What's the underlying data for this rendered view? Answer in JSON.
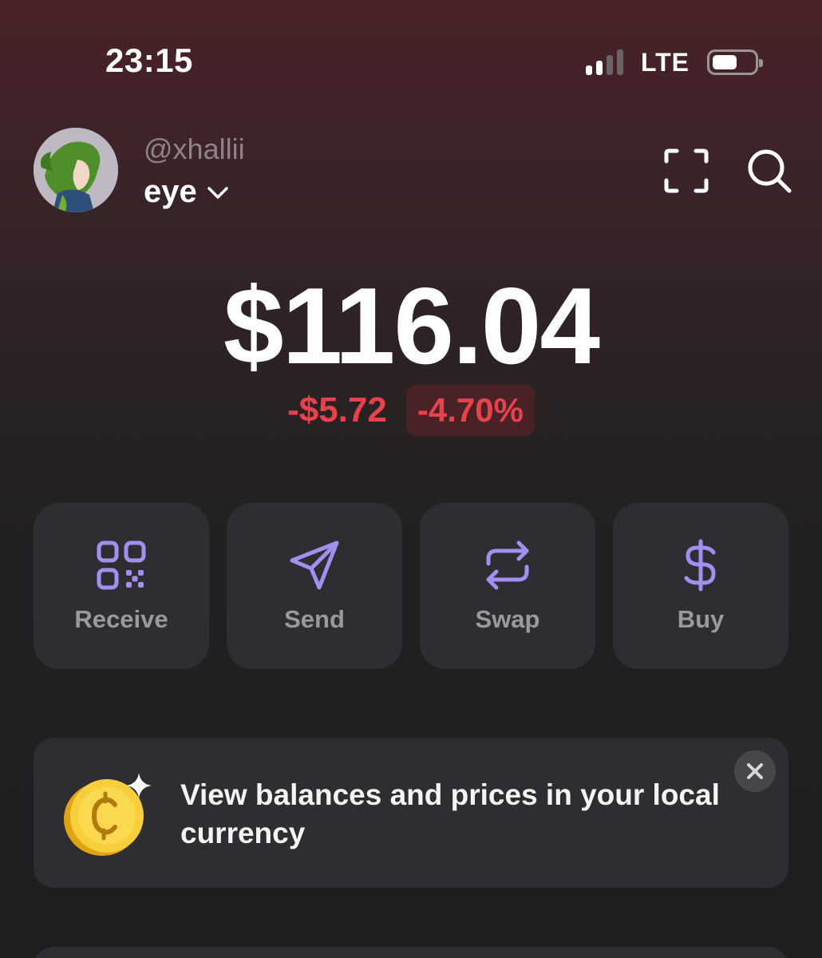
{
  "status_bar": {
    "time": "23:15",
    "network": "LTE",
    "signal_bars_active": 2,
    "signal_bars_total": 4,
    "battery_level": 0.6
  },
  "header": {
    "handle": "@xhallii",
    "account_name": "eye",
    "icons": [
      "scan-icon",
      "search-icon"
    ]
  },
  "balance": {
    "amount": "$116.04",
    "change_amount": "-$5.72",
    "change_percent": "-4.70%"
  },
  "actions": [
    {
      "label": "Receive",
      "icon": "qr-code-icon"
    },
    {
      "label": "Send",
      "icon": "send-icon"
    },
    {
      "label": "Swap",
      "icon": "swap-icon"
    },
    {
      "label": "Buy",
      "icon": "dollar-icon"
    }
  ],
  "banner": {
    "text": "View balances and prices in your local currency",
    "icon": "coin-icon"
  },
  "colors": {
    "accent": "#a48ff0",
    "negative": "#e8424d",
    "card": "#2e2d31"
  }
}
